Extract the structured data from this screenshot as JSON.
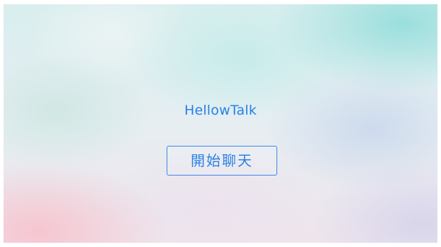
{
  "app": {
    "title": "HellowTalk"
  },
  "actions": {
    "start_chat_label": "開始聊天"
  },
  "colors": {
    "accent": "#2a7fe6"
  }
}
